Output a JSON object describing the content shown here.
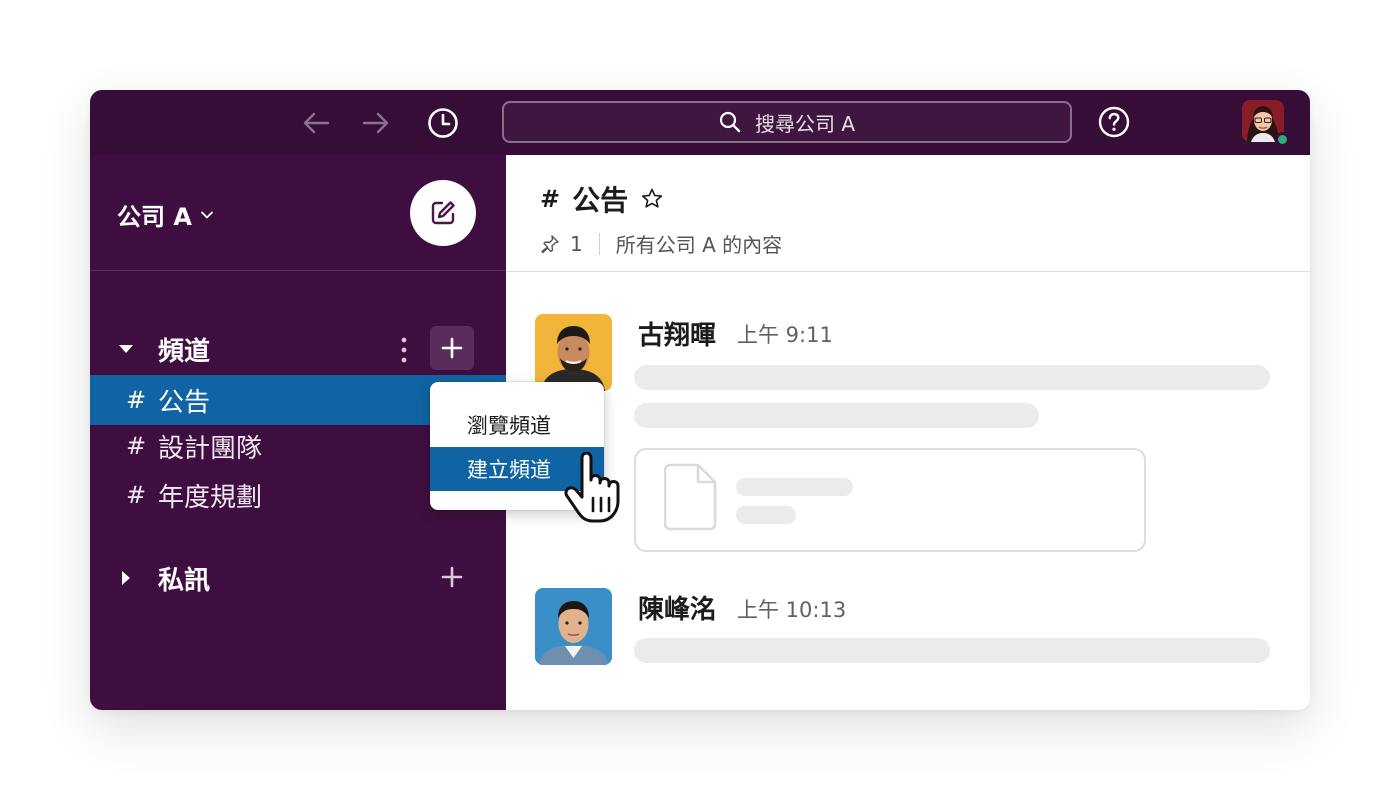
{
  "topbar": {
    "back_icon": "arrow-left-icon",
    "forward_icon": "arrow-right-icon",
    "history_icon": "clock-icon",
    "search_placeholder": "搜尋公司 A",
    "help_icon": "question-circle-icon",
    "presence_color": "#2bac76"
  },
  "sidebar": {
    "workspace_name": "公司 A",
    "compose_icon": "compose-icon",
    "channels_label": "頻道",
    "channels": [
      {
        "hash": "#",
        "name": "公告",
        "active": true
      },
      {
        "hash": "#",
        "name": "設計團隊",
        "active": false
      },
      {
        "hash": "#",
        "name": "年度規劃",
        "active": false
      }
    ],
    "dms_label": "私訊"
  },
  "dropdown": {
    "items": [
      "瀏覽頻道",
      "建立頻道"
    ],
    "highlighted": 1
  },
  "channel": {
    "hash": "#",
    "name": "公告",
    "pinned_count": "1",
    "topic": "所有公司 A 的內容"
  },
  "messages": [
    {
      "author": "古翔暉",
      "time": "上午 9:11"
    },
    {
      "author": "陳峰洺",
      "time": "上午 10:13"
    }
  ],
  "colors": {
    "topbar": "#350d36",
    "sidebar": "#3f0e40",
    "active": "#1164a3"
  }
}
